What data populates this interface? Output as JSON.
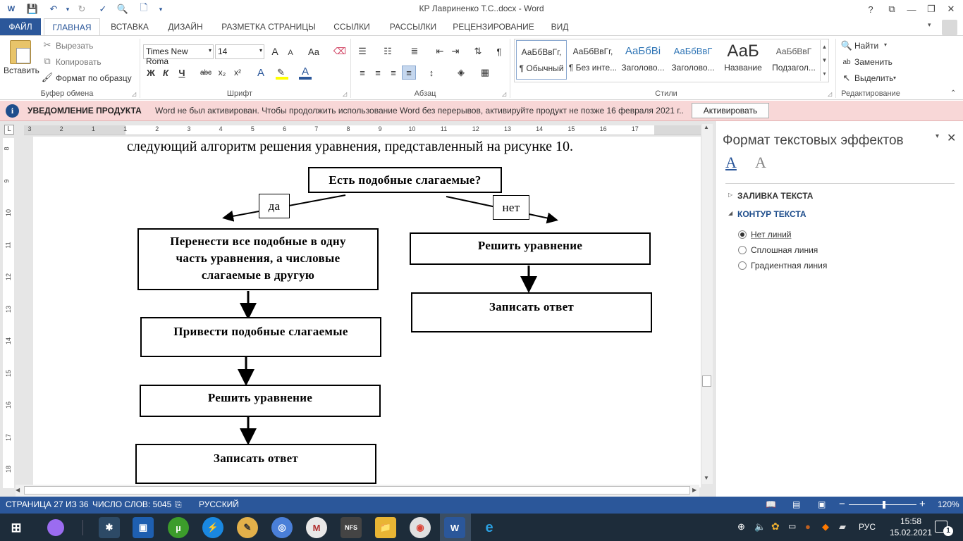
{
  "window": {
    "title": "КР Лавриненко Т.С..docx - Word",
    "help": "?",
    "restore_ribbon": "⧉",
    "minimize": "—",
    "maximize": "❐",
    "close": "✕"
  },
  "tabs": [
    {
      "label": "ФАЙЛ",
      "active": false
    },
    {
      "label": "ГЛАВНАЯ",
      "active": true
    },
    {
      "label": "ВСТАВКА",
      "active": false
    },
    {
      "label": "ДИЗАЙН",
      "active": false
    },
    {
      "label": "РАЗМЕТКА СТРАНИЦЫ",
      "active": false
    },
    {
      "label": "ССЫЛКИ",
      "active": false
    },
    {
      "label": "РАССЫЛКИ",
      "active": false
    },
    {
      "label": "РЕЦЕНЗИРОВАНИЕ",
      "active": false
    },
    {
      "label": "ВИД",
      "active": false
    }
  ],
  "clipboard": {
    "paste": "Вставить",
    "cut": "Вырезать",
    "copy": "Копировать",
    "format_painter": "Формат по образцу",
    "label": "Буфер обмена"
  },
  "font": {
    "name": "Times New Roma",
    "size": "14",
    "label": "Шрифт",
    "case": "Aa",
    "grow": "A",
    "shrink": "A",
    "bold": "Ж",
    "italic": "К",
    "underline": "Ч",
    "strike": "abc",
    "sub": "x₂",
    "sup": "x²"
  },
  "paragraph": {
    "label": "Абзац",
    "pilcrow": "¶"
  },
  "styles": {
    "label": "Стили",
    "items": [
      {
        "preview": "АаБбВвГг,",
        "name": "¶ Обычный"
      },
      {
        "preview": "АаБбВвГг,",
        "name": "¶ Без инте..."
      },
      {
        "preview": "АаБбВі",
        "name": "Заголово..."
      },
      {
        "preview": "АаБбВвГ",
        "name": "Заголово..."
      },
      {
        "preview": "АаБ",
        "name": "Название"
      },
      {
        "preview": "АаБбВвГ",
        "name": "Подзагол..."
      }
    ]
  },
  "editing": {
    "label": "Редактирование",
    "find": "Найти",
    "replace": "Заменить",
    "select": "Выделить"
  },
  "notification": {
    "title": "УВЕДОМЛЕНИЕ ПРОДУКТА",
    "message": "Word не был активирован. Чтобы продолжить использование Word без перерывов, активируйте продукт не позже 16 февраля 2021 г..",
    "button": "Активировать"
  },
  "ruler": {
    "h_ticks": [
      "3",
      "2",
      "1",
      "1",
      "2",
      "3",
      "4",
      "5",
      "6",
      "7",
      "8",
      "9",
      "10",
      "11",
      "12",
      "13",
      "14",
      "15",
      "16",
      "17"
    ],
    "v_ticks": [
      "8",
      "9",
      "10",
      "11",
      "12",
      "13",
      "14",
      "15",
      "16",
      "17",
      "18"
    ]
  },
  "document": {
    "text_line": "следующий алгоритм решения уравнения, представленный на рисунке 10.",
    "flow": {
      "question": "Есть подобные слагаемые?",
      "yes": "да",
      "no": "нет",
      "left": [
        "Перенести все подобные в одну часть уравнения, а числовые слагаемые в другую",
        "Привести подобные слагаемые",
        "Решить уравнение",
        "Записать ответ"
      ],
      "right": [
        "Решить уравнение",
        "Записать ответ"
      ]
    }
  },
  "pane": {
    "title": "Формат текстовых эффектов",
    "sections": [
      {
        "label": "ЗАЛИВКА ТЕКСТА",
        "expanded": false
      },
      {
        "label": "КОНТУР ТЕКСТА",
        "expanded": true
      }
    ],
    "options": [
      {
        "label": "Нет линий",
        "checked": true
      },
      {
        "label": "Сплошная линия",
        "checked": false
      },
      {
        "label": "Градиентная линия",
        "checked": false
      }
    ]
  },
  "status": {
    "page": "СТРАНИЦА 27 ИЗ 36",
    "words": "ЧИСЛО СЛОВ: 5045",
    "language": "РУССКИЙ",
    "zoom": "120%"
  },
  "taskbar": {
    "lang": "РУС",
    "time": "15:58",
    "date": "15.02.2021",
    "notifications": "1"
  }
}
